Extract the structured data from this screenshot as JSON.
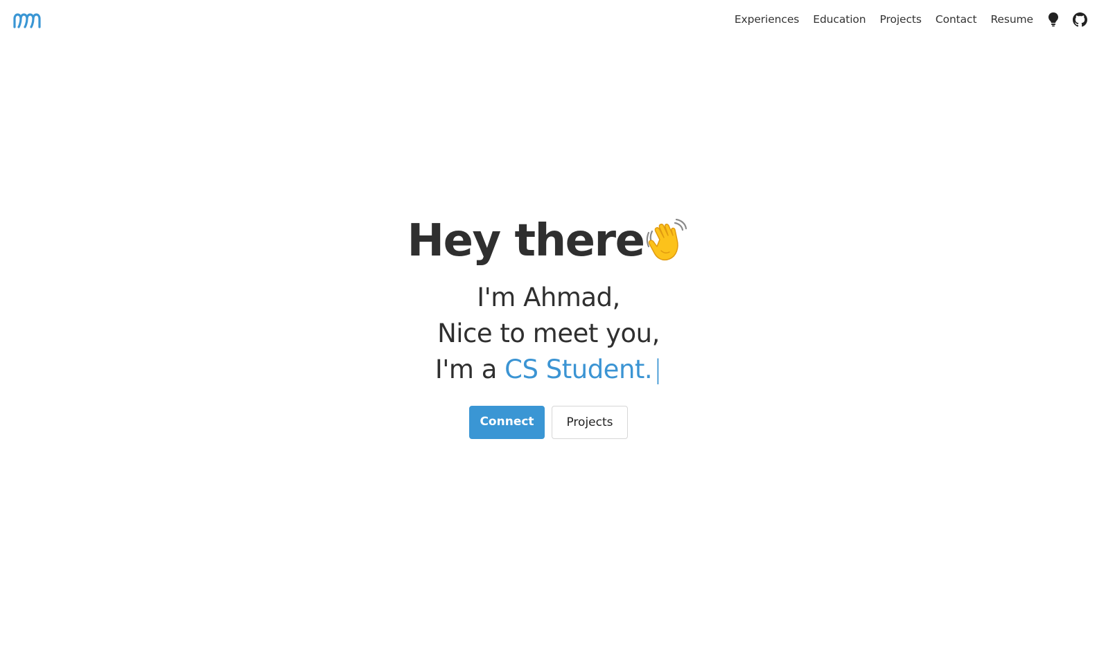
{
  "brand": {
    "logo_icon": "mm-logo-icon",
    "accent_color": "#3a96d4"
  },
  "nav": {
    "links": [
      {
        "label": "Experiences"
      },
      {
        "label": "Education"
      },
      {
        "label": "Projects"
      },
      {
        "label": "Contact"
      },
      {
        "label": "Resume"
      }
    ],
    "theme_toggle_icon": "lightbulb-icon",
    "github_icon": "github-icon"
  },
  "hero": {
    "title": "Hey there",
    "title_emoji_icon": "waving-hand-icon",
    "intro": "I'm Ahmad,",
    "greeting": "Nice to meet you,",
    "role_prefix": "I'm a ",
    "role": "CS Student.",
    "cursor": "|",
    "primary_button": "Connect",
    "secondary_button": "Projects"
  }
}
